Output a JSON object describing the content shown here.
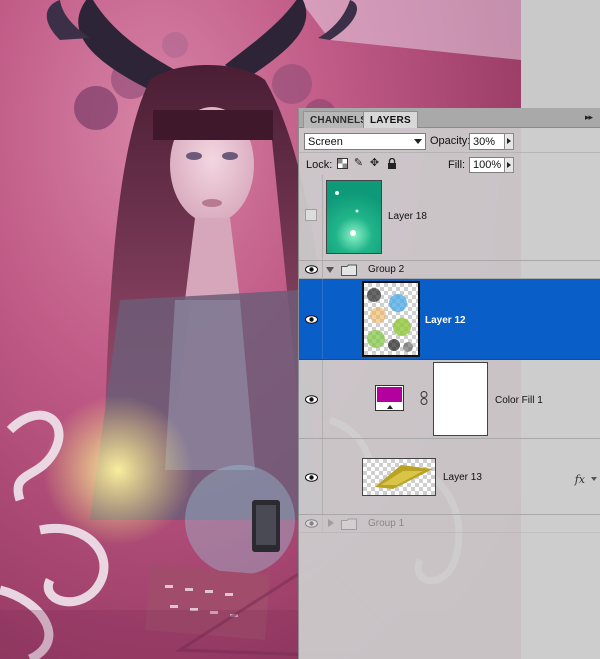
{
  "panel": {
    "tabs": [
      {
        "label": "CHANNELS",
        "active": false
      },
      {
        "label": "LAYERS",
        "active": true
      }
    ],
    "menu_icon": "panel-menu-icon"
  },
  "blend_mode": {
    "value": "Screen",
    "options_visible": [
      "Screen"
    ]
  },
  "opacity": {
    "label": "Opacity:",
    "value": "30%"
  },
  "lock": {
    "label": "Lock:",
    "icons": [
      "lock-transparency-icon",
      "lock-image-icon",
      "lock-position-icon",
      "lock-all-icon"
    ]
  },
  "fill": {
    "label": "Fill:",
    "value": "100%"
  },
  "layers": [
    {
      "name": "Layer 18",
      "visible": false,
      "thumbnail": "green-glow-thumbnail"
    },
    {
      "name": "Group 2",
      "visible": true,
      "type": "group",
      "expanded": true
    },
    {
      "name": "Layer 12",
      "visible": true,
      "selected": true,
      "thumbnail": "colorful-blur-thumbnail"
    },
    {
      "name": "Color Fill 1",
      "visible": true,
      "type": "fill",
      "fill_color": "#b4009c"
    },
    {
      "name": "Layer 13",
      "visible": true,
      "thumbnail": "yellow-shape-thumbnail",
      "has_effects": true
    },
    {
      "name": "Group 1",
      "visible": true,
      "type": "group",
      "expanded": false
    }
  ],
  "fx_label": "fx",
  "colors": {
    "selection": "#0a5ec8",
    "panel_bg": "#cdcdcd",
    "canvas_pink": "#c05a86"
  }
}
